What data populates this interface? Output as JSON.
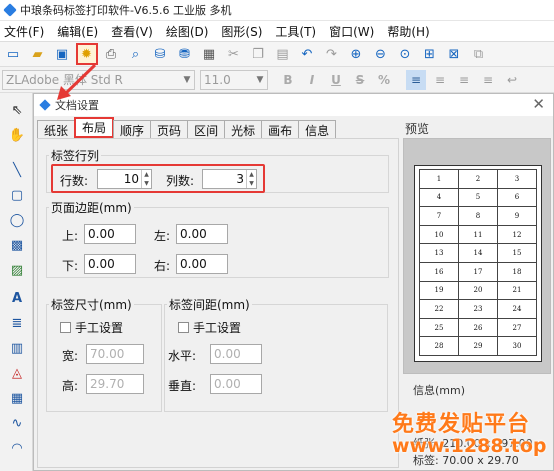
{
  "window": {
    "title": "中琅条码标签打印软件-V6.5.6 工业版 多机"
  },
  "menu": [
    "文件(F)",
    "编辑(E)",
    "查看(V)",
    "绘图(D)",
    "图形(S)",
    "工具(T)",
    "窗口(W)",
    "帮助(H)"
  ],
  "fontbar": {
    "font": "ZLAdobe 黑体 Std R",
    "size": "11.0",
    "bold": "B",
    "italic": "I",
    "underline": "U",
    "strike": "S",
    "percent": "%"
  },
  "dialog": {
    "title": "文档设置",
    "tabs": [
      "纸张",
      "布局",
      "顺序",
      "页码",
      "区间",
      "光标",
      "画布",
      "信息"
    ],
    "rows_cols": {
      "legend": "标签行列",
      "rows_label": "行数:",
      "rows_value": "10",
      "cols_label": "列数:",
      "cols_value": "3"
    },
    "margins": {
      "legend": "页面边距(mm)",
      "top_label": "上:",
      "top": "0.00",
      "left_label": "左:",
      "left": "0.00",
      "bottom_label": "下:",
      "bottom": "0.00",
      "right_label": "右:",
      "right": "0.00"
    },
    "label_size": {
      "legend": "标签尺寸(mm)",
      "manual": "手工设置",
      "width_label": "宽:",
      "width": "70.00",
      "height_label": "高:",
      "height": "29.70"
    },
    "label_gap": {
      "legend": "标签间距(mm)",
      "manual": "手工设置",
      "h_label": "水平:",
      "h": "0.00",
      "v_label": "垂直:",
      "v": "0.00"
    },
    "preview": {
      "legend": "预览",
      "cells": [
        "1",
        "2",
        "3",
        "4",
        "5",
        "6",
        "7",
        "8",
        "9",
        "10",
        "11",
        "12",
        "13",
        "14",
        "15",
        "16",
        "17",
        "18",
        "19",
        "20",
        "21",
        "22",
        "23",
        "24",
        "25",
        "26",
        "27",
        "28",
        "29",
        "30"
      ]
    },
    "info": {
      "legend": "信息(mm)",
      "paper": "纸张: 210.00 x 297.00",
      "label": "标签: 70.00 x 29.70"
    }
  },
  "watermark": {
    "line1": "免费发贴平台",
    "line2": "www.1288.top"
  },
  "colors": {
    "highlight": "#e53935",
    "watermark": "#ff7a1a",
    "icon_blue": "#1e56a0"
  }
}
